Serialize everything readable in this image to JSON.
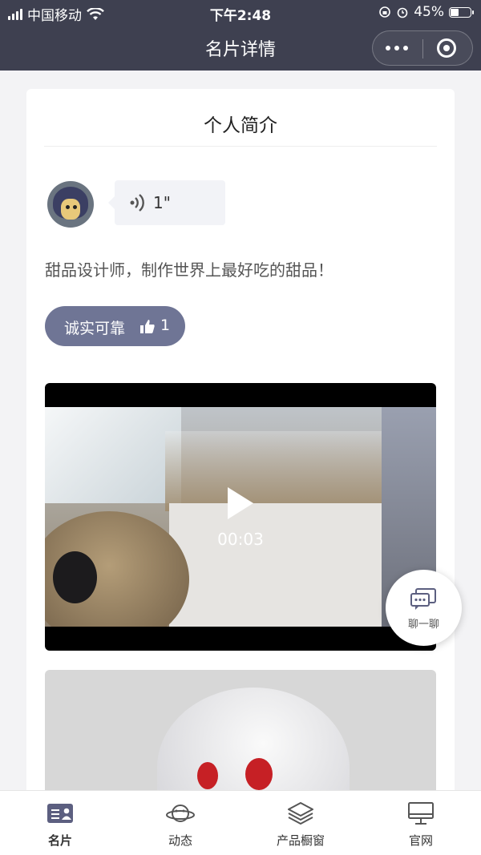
{
  "status_bar": {
    "carrier": "中国移动",
    "time": "下午2:48",
    "battery": "45%",
    "battery_level": 0.45
  },
  "nav": {
    "title": "名片详情"
  },
  "profile": {
    "section_title": "个人简介",
    "voice_duration": "1\"",
    "bio": "甜品设计师，制作世界上最好吃的甜品！",
    "tag": {
      "label": "诚实可靠",
      "likes": "1"
    },
    "video_time": "00:03"
  },
  "chat_button": {
    "label": "聊一聊"
  },
  "tabbar": {
    "items": [
      {
        "label": "名片",
        "icon": "card-icon"
      },
      {
        "label": "动态",
        "icon": "planet-icon"
      },
      {
        "label": "产品橱窗",
        "icon": "layers-icon"
      },
      {
        "label": "官网",
        "icon": "monitor-icon"
      }
    ]
  },
  "colors": {
    "header": "#3e4050",
    "tag": "#6f7595",
    "accent": "#5c5f80"
  }
}
